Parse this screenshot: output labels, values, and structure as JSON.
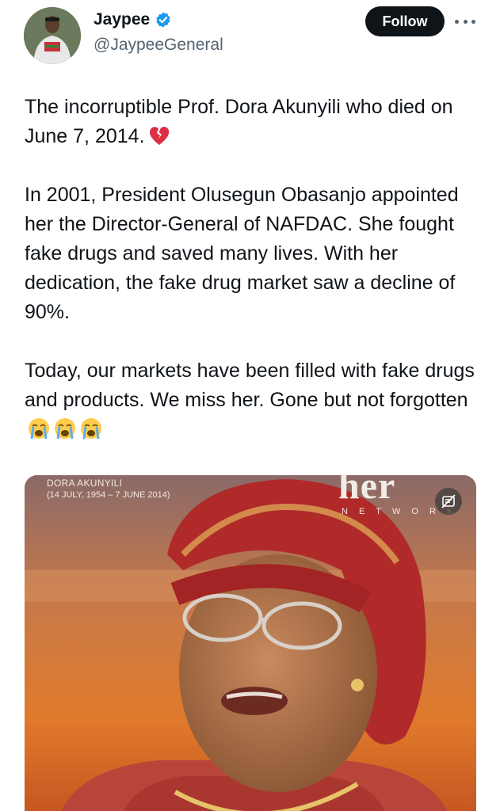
{
  "author": {
    "display_name": "Jaypee",
    "handle": "@JaypeeGeneral",
    "verified": true,
    "verified_color": "#1d9bf0",
    "avatar_icon": "profile-photo"
  },
  "actions": {
    "follow_label": "Follow",
    "more_icon": "ellipsis-icon"
  },
  "tweet": {
    "paragraphs": [
      "The incorruptible Prof. Dora Akunyili who died on June 7, 2014.",
      "In 2001, President Olusegun Obasanjo appointed her the Director-General of NAFDAC. She fought fake drugs and saved many lives. With her dedication, the fake drug market saw a decline of 90%.",
      "Today, our markets have been filled with fake drugs and products. We miss her. Gone but not forgotten"
    ],
    "emojis": {
      "broken_heart": "💔",
      "crying": [
        "😭",
        "😭",
        "😭"
      ]
    }
  },
  "media": {
    "caption_name": "DORA AKUNYILI",
    "caption_dates": "(14 JULY, 1954 – 7 JUNE 2014)",
    "watermark": "her",
    "watermark_sub": "NETWORK",
    "overlay_icon": "hide-media-icon"
  },
  "colors": {
    "text": "#0f1419",
    "secondary": "#536471",
    "button_bg": "#0f1419",
    "button_text": "#ffffff"
  }
}
